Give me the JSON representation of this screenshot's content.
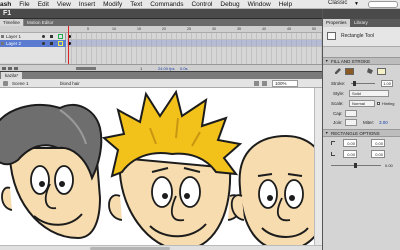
{
  "menubar": {
    "app": "ash",
    "items": [
      "File",
      "Edit",
      "View",
      "Insert",
      "Modify",
      "Text",
      "Commands",
      "Control",
      "Debug",
      "Window",
      "Help"
    ],
    "workspace": "Classic"
  },
  "document": {
    "title": "F1"
  },
  "timeline": {
    "tabs": [
      "Timeline",
      "Motion Editor"
    ],
    "layers": [
      {
        "name": "Layer 1",
        "selected": false
      },
      {
        "name": "Layer 2",
        "selected": true
      }
    ],
    "ruler": [
      "5",
      "10",
      "15",
      "20",
      "25",
      "30",
      "35",
      "40",
      "45",
      "50"
    ],
    "fps": "24.00 fps",
    "time": "0.0s",
    "frame": "1"
  },
  "stage": {
    "tab": "kazila*",
    "scene": "Scene 1",
    "symbol": "blond hair",
    "zoom": "100%"
  },
  "panel": {
    "tabs": [
      "Properties",
      "Library"
    ],
    "tool": "Rectangle Tool",
    "fill_stroke": {
      "header": "FILL AND STROKE",
      "stroke_color": "#8a5a22",
      "fill_color": "#f4f0c8",
      "stroke_label": "Stroke:",
      "stroke_value": "1.00",
      "style_label": "Style:",
      "style_value": "Solid",
      "scale_label": "Scale:",
      "scale_value": "Normal",
      "hinting_label": "Hinting",
      "cap_label": "Cap:",
      "join_label": "Join:",
      "miter_label": "Miter:",
      "miter_value": "3.00"
    },
    "rect_options": {
      "header": "RECTANGLE OPTIONS",
      "values": [
        "0.00",
        "0.00",
        "0.00",
        "0.00"
      ],
      "slider_value": "0.00"
    }
  },
  "colors": {
    "hair_blond": "#f2c21a",
    "hair_grey": "#6e6e6e",
    "skin": "#f6dcae",
    "outline": "#1c1c1c"
  }
}
